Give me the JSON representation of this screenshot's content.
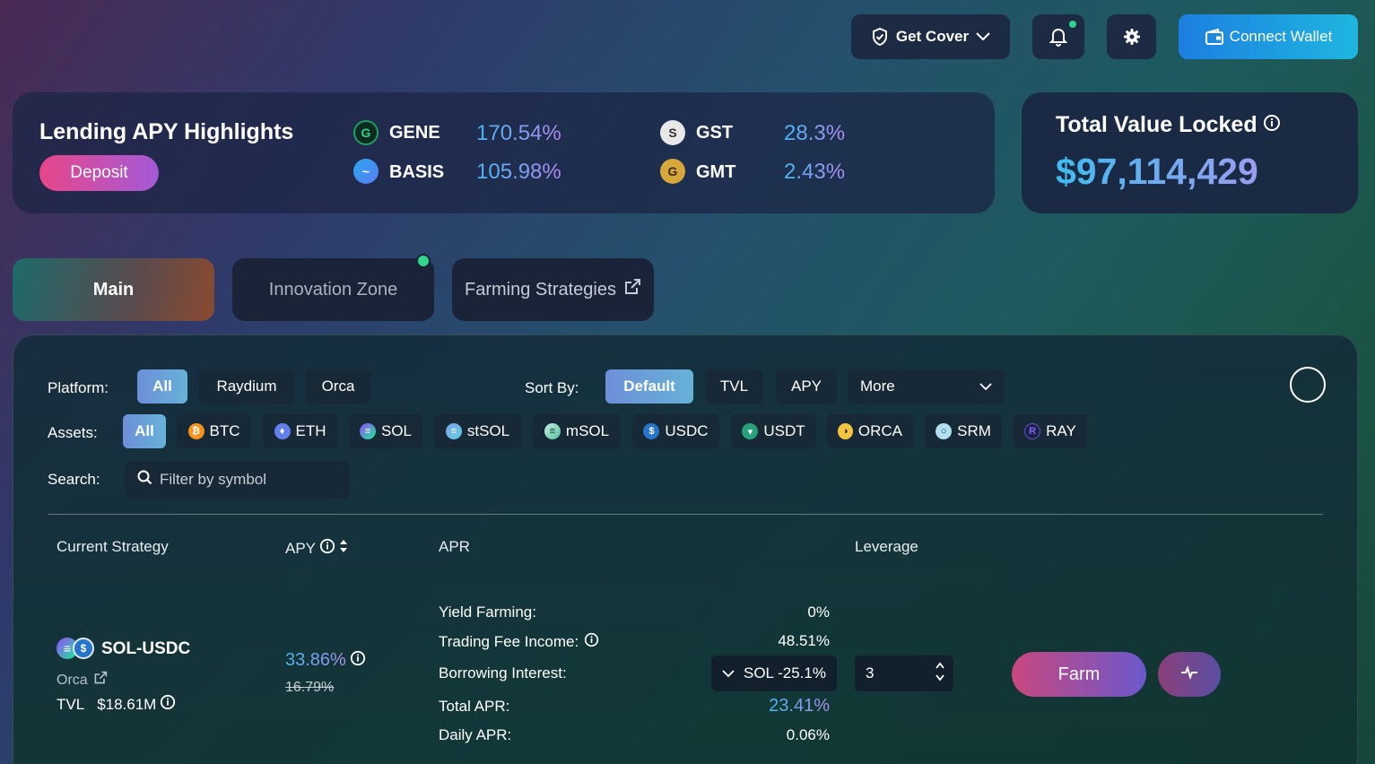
{
  "header": {
    "get_cover_label": "Get Cover",
    "connect_wallet_label": "Connect Wallet"
  },
  "highlights": {
    "title": "Lending APY Highlights",
    "deposit_label": "Deposit",
    "tokens": [
      {
        "symbol": "GENE",
        "apy": "170.54%",
        "icon": "gene-icon"
      },
      {
        "symbol": "BASIS",
        "apy": "105.98%",
        "icon": "basis-icon"
      },
      {
        "symbol": "GST",
        "apy": "28.3%",
        "icon": "gst-icon"
      },
      {
        "symbol": "GMT",
        "apy": "2.43%",
        "icon": "gmt-icon"
      }
    ]
  },
  "tvl": {
    "title": "Total Value Locked",
    "value": "$97,114,429"
  },
  "tabs": [
    {
      "label": "Main",
      "active": true
    },
    {
      "label": "Innovation Zone",
      "active": false
    },
    {
      "label": "Farming Strategies",
      "active": false
    }
  ],
  "filters": {
    "platform_label": "Platform:",
    "platforms": [
      "All",
      "Raydium",
      "Orca"
    ],
    "sort_label": "Sort By:",
    "sorts": [
      "Default",
      "TVL",
      "APY"
    ],
    "more_label": "More",
    "assets_label": "Assets:",
    "assets": [
      "All",
      "BTC",
      "ETH",
      "SOL",
      "stSOL",
      "mSOL",
      "USDC",
      "USDT",
      "ORCA",
      "SRM",
      "RAY"
    ],
    "search_label": "Search:",
    "search_placeholder": "Filter by symbol"
  },
  "table": {
    "headers": [
      "Current Strategy",
      "APY",
      "APR",
      "Leverage"
    ]
  },
  "strategy": {
    "pair": "SOL-USDC",
    "platform": "Orca",
    "tvl_label": "TVL",
    "tvl_value": "$18.61M",
    "apy": "33.86%",
    "apy_old": "16.79%",
    "apr_rows": [
      {
        "label": "Yield Farming:",
        "value": "0%"
      },
      {
        "label": "Trading Fee Income:",
        "value": "48.51%"
      },
      {
        "label": "Borrowing Interest:",
        "value": "SOL -25.1%"
      },
      {
        "label": "Total APR:",
        "value": "23.41%"
      },
      {
        "label": "Daily APR:",
        "value": "0.06%"
      }
    ],
    "leverage": "3",
    "farm_label": "Farm"
  },
  "colors": {
    "accent_green": "#2fd68a",
    "connect_wallet": "#1b8ce0",
    "deposit_pink": "#e8468a"
  }
}
